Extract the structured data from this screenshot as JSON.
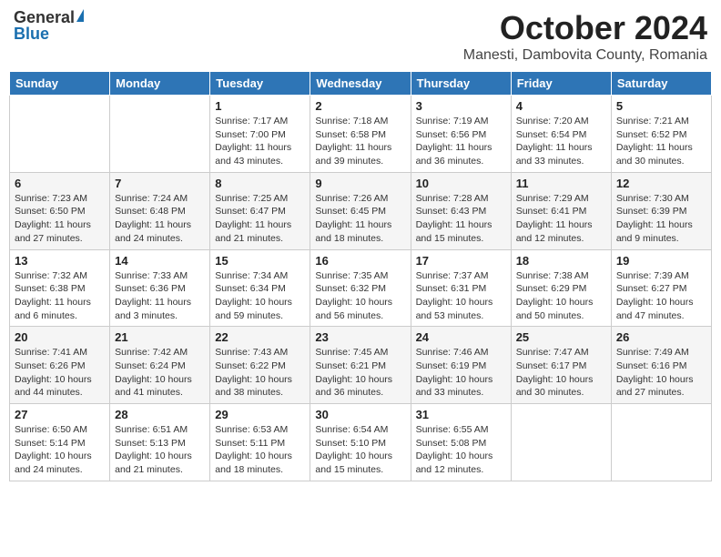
{
  "header": {
    "logo_general": "General",
    "logo_blue": "Blue",
    "month": "October 2024",
    "location": "Manesti, Dambovita County, Romania"
  },
  "days_of_week": [
    "Sunday",
    "Monday",
    "Tuesday",
    "Wednesday",
    "Thursday",
    "Friday",
    "Saturday"
  ],
  "weeks": [
    [
      {
        "day": "",
        "sunrise": "",
        "sunset": "",
        "daylight": ""
      },
      {
        "day": "",
        "sunrise": "",
        "sunset": "",
        "daylight": ""
      },
      {
        "day": "1",
        "sunrise": "Sunrise: 7:17 AM",
        "sunset": "Sunset: 7:00 PM",
        "daylight": "Daylight: 11 hours and 43 minutes."
      },
      {
        "day": "2",
        "sunrise": "Sunrise: 7:18 AM",
        "sunset": "Sunset: 6:58 PM",
        "daylight": "Daylight: 11 hours and 39 minutes."
      },
      {
        "day": "3",
        "sunrise": "Sunrise: 7:19 AM",
        "sunset": "Sunset: 6:56 PM",
        "daylight": "Daylight: 11 hours and 36 minutes."
      },
      {
        "day": "4",
        "sunrise": "Sunrise: 7:20 AM",
        "sunset": "Sunset: 6:54 PM",
        "daylight": "Daylight: 11 hours and 33 minutes."
      },
      {
        "day": "5",
        "sunrise": "Sunrise: 7:21 AM",
        "sunset": "Sunset: 6:52 PM",
        "daylight": "Daylight: 11 hours and 30 minutes."
      }
    ],
    [
      {
        "day": "6",
        "sunrise": "Sunrise: 7:23 AM",
        "sunset": "Sunset: 6:50 PM",
        "daylight": "Daylight: 11 hours and 27 minutes."
      },
      {
        "day": "7",
        "sunrise": "Sunrise: 7:24 AM",
        "sunset": "Sunset: 6:48 PM",
        "daylight": "Daylight: 11 hours and 24 minutes."
      },
      {
        "day": "8",
        "sunrise": "Sunrise: 7:25 AM",
        "sunset": "Sunset: 6:47 PM",
        "daylight": "Daylight: 11 hours and 21 minutes."
      },
      {
        "day": "9",
        "sunrise": "Sunrise: 7:26 AM",
        "sunset": "Sunset: 6:45 PM",
        "daylight": "Daylight: 11 hours and 18 minutes."
      },
      {
        "day": "10",
        "sunrise": "Sunrise: 7:28 AM",
        "sunset": "Sunset: 6:43 PM",
        "daylight": "Daylight: 11 hours and 15 minutes."
      },
      {
        "day": "11",
        "sunrise": "Sunrise: 7:29 AM",
        "sunset": "Sunset: 6:41 PM",
        "daylight": "Daylight: 11 hours and 12 minutes."
      },
      {
        "day": "12",
        "sunrise": "Sunrise: 7:30 AM",
        "sunset": "Sunset: 6:39 PM",
        "daylight": "Daylight: 11 hours and 9 minutes."
      }
    ],
    [
      {
        "day": "13",
        "sunrise": "Sunrise: 7:32 AM",
        "sunset": "Sunset: 6:38 PM",
        "daylight": "Daylight: 11 hours and 6 minutes."
      },
      {
        "day": "14",
        "sunrise": "Sunrise: 7:33 AM",
        "sunset": "Sunset: 6:36 PM",
        "daylight": "Daylight: 11 hours and 3 minutes."
      },
      {
        "day": "15",
        "sunrise": "Sunrise: 7:34 AM",
        "sunset": "Sunset: 6:34 PM",
        "daylight": "Daylight: 10 hours and 59 minutes."
      },
      {
        "day": "16",
        "sunrise": "Sunrise: 7:35 AM",
        "sunset": "Sunset: 6:32 PM",
        "daylight": "Daylight: 10 hours and 56 minutes."
      },
      {
        "day": "17",
        "sunrise": "Sunrise: 7:37 AM",
        "sunset": "Sunset: 6:31 PM",
        "daylight": "Daylight: 10 hours and 53 minutes."
      },
      {
        "day": "18",
        "sunrise": "Sunrise: 7:38 AM",
        "sunset": "Sunset: 6:29 PM",
        "daylight": "Daylight: 10 hours and 50 minutes."
      },
      {
        "day": "19",
        "sunrise": "Sunrise: 7:39 AM",
        "sunset": "Sunset: 6:27 PM",
        "daylight": "Daylight: 10 hours and 47 minutes."
      }
    ],
    [
      {
        "day": "20",
        "sunrise": "Sunrise: 7:41 AM",
        "sunset": "Sunset: 6:26 PM",
        "daylight": "Daylight: 10 hours and 44 minutes."
      },
      {
        "day": "21",
        "sunrise": "Sunrise: 7:42 AM",
        "sunset": "Sunset: 6:24 PM",
        "daylight": "Daylight: 10 hours and 41 minutes."
      },
      {
        "day": "22",
        "sunrise": "Sunrise: 7:43 AM",
        "sunset": "Sunset: 6:22 PM",
        "daylight": "Daylight: 10 hours and 38 minutes."
      },
      {
        "day": "23",
        "sunrise": "Sunrise: 7:45 AM",
        "sunset": "Sunset: 6:21 PM",
        "daylight": "Daylight: 10 hours and 36 minutes."
      },
      {
        "day": "24",
        "sunrise": "Sunrise: 7:46 AM",
        "sunset": "Sunset: 6:19 PM",
        "daylight": "Daylight: 10 hours and 33 minutes."
      },
      {
        "day": "25",
        "sunrise": "Sunrise: 7:47 AM",
        "sunset": "Sunset: 6:17 PM",
        "daylight": "Daylight: 10 hours and 30 minutes."
      },
      {
        "day": "26",
        "sunrise": "Sunrise: 7:49 AM",
        "sunset": "Sunset: 6:16 PM",
        "daylight": "Daylight: 10 hours and 27 minutes."
      }
    ],
    [
      {
        "day": "27",
        "sunrise": "Sunrise: 6:50 AM",
        "sunset": "Sunset: 5:14 PM",
        "daylight": "Daylight: 10 hours and 24 minutes."
      },
      {
        "day": "28",
        "sunrise": "Sunrise: 6:51 AM",
        "sunset": "Sunset: 5:13 PM",
        "daylight": "Daylight: 10 hours and 21 minutes."
      },
      {
        "day": "29",
        "sunrise": "Sunrise: 6:53 AM",
        "sunset": "Sunset: 5:11 PM",
        "daylight": "Daylight: 10 hours and 18 minutes."
      },
      {
        "day": "30",
        "sunrise": "Sunrise: 6:54 AM",
        "sunset": "Sunset: 5:10 PM",
        "daylight": "Daylight: 10 hours and 15 minutes."
      },
      {
        "day": "31",
        "sunrise": "Sunrise: 6:55 AM",
        "sunset": "Sunset: 5:08 PM",
        "daylight": "Daylight: 10 hours and 12 minutes."
      },
      {
        "day": "",
        "sunrise": "",
        "sunset": "",
        "daylight": ""
      },
      {
        "day": "",
        "sunrise": "",
        "sunset": "",
        "daylight": ""
      }
    ]
  ]
}
